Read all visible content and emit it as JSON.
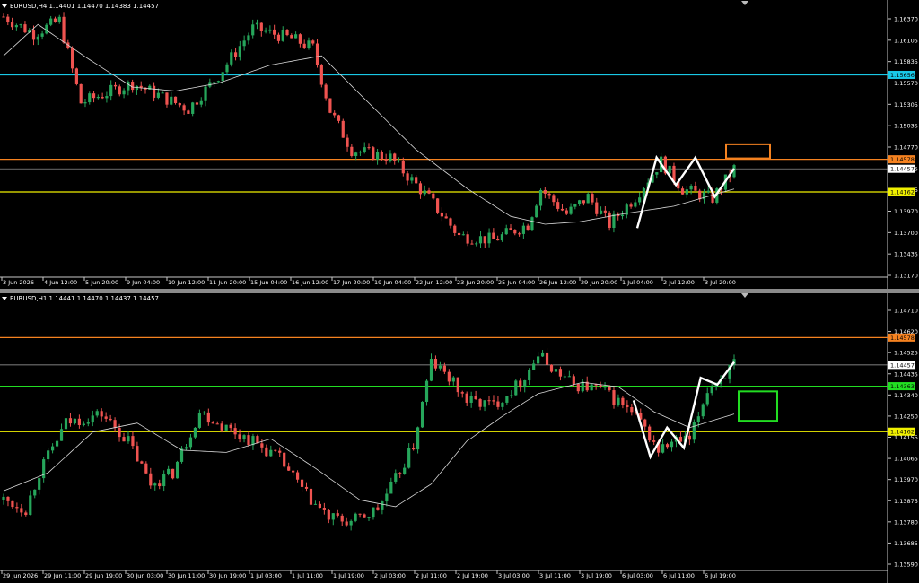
{
  "chart_data": [
    {
      "type": "candlestick",
      "title": "EURUSD,H4  1.14401 1.14470 1.14383 1.14457",
      "yticks": [
        "1.16370",
        "1.16105",
        "1.15835",
        "1.15570",
        "1.15305",
        "1.15035",
        "1.14770",
        "1.14505",
        "1.14235",
        "1.13970",
        "1.13700",
        "1.13435",
        "1.13170"
      ],
      "ylim": [
        1.1312,
        1.1652
      ],
      "xticks": [
        "3 Jun 2026",
        "4 Jun 12:00",
        "5 Jun 20:00",
        "9 Jun 04:00",
        "10 Jun 12:00",
        "11 Jun 20:00",
        "15 Jun 04:00",
        "16 Jun 12:00",
        "17 Jun 20:00",
        "19 Jun 04:00",
        "22 Jun 12:00",
        "23 Jun 20:00",
        "25 Jun 04:00",
        "26 Jun 12:00",
        "29 Jun 20:00",
        "1 Jul 04:00",
        "2 Jul 12:00",
        "3 Jul 20:00"
      ],
      "hlines": [
        {
          "value": 1.15656,
          "label": "1.15656",
          "color": "#19c8e6"
        },
        {
          "value": 1.14578,
          "label": "1.14578",
          "color": "#f58220"
        },
        {
          "value": 1.14457,
          "label": "1.14457",
          "color": "#aaaaaa"
        },
        {
          "value": 1.14162,
          "label": "1.14162",
          "color": "#f0f000"
        }
      ],
      "box": {
        "color": "#f58220",
        "price_top": 1.1477,
        "price_bottom": 1.1459
      },
      "zigzag": [
        1.137,
        1.146,
        1.1425,
        1.146,
        1.141,
        1.1446
      ],
      "anchors": [
        {
          "i": 0,
          "v": 1.164
        },
        {
          "i": 7,
          "v": 1.1618
        },
        {
          "i": 13,
          "v": 1.1635
        },
        {
          "i": 18,
          "v": 1.153
        },
        {
          "i": 30,
          "v": 1.1555
        },
        {
          "i": 43,
          "v": 1.1522
        },
        {
          "i": 50,
          "v": 1.1565
        },
        {
          "i": 58,
          "v": 1.1625
        },
        {
          "i": 67,
          "v": 1.1612
        },
        {
          "i": 72,
          "v": 1.16
        },
        {
          "i": 76,
          "v": 1.152
        },
        {
          "i": 81,
          "v": 1.147
        },
        {
          "i": 90,
          "v": 1.146
        },
        {
          "i": 99,
          "v": 1.1408
        },
        {
          "i": 106,
          "v": 1.136
        },
        {
          "i": 114,
          "v": 1.1355
        },
        {
          "i": 122,
          "v": 1.1375
        },
        {
          "i": 125,
          "v": 1.142
        },
        {
          "i": 131,
          "v": 1.1388
        },
        {
          "i": 136,
          "v": 1.141
        },
        {
          "i": 141,
          "v": 1.1375
        },
        {
          "i": 147,
          "v": 1.141
        },
        {
          "i": 153,
          "v": 1.1455
        },
        {
          "i": 158,
          "v": 1.142
        },
        {
          "i": 165,
          "v": 1.1408
        },
        {
          "i": 170,
          "v": 1.1446
        }
      ],
      "ma": [
        {
          "i": 0,
          "v": 1.159
        },
        {
          "i": 8,
          "v": 1.163
        },
        {
          "i": 20,
          "v": 1.1585
        },
        {
          "i": 30,
          "v": 1.155
        },
        {
          "i": 40,
          "v": 1.1545
        },
        {
          "i": 50,
          "v": 1.1555
        },
        {
          "i": 62,
          "v": 1.1578
        },
        {
          "i": 74,
          "v": 1.159
        },
        {
          "i": 84,
          "v": 1.1535
        },
        {
          "i": 96,
          "v": 1.147
        },
        {
          "i": 108,
          "v": 1.142
        },
        {
          "i": 118,
          "v": 1.1385
        },
        {
          "i": 126,
          "v": 1.1375
        },
        {
          "i": 134,
          "v": 1.1378
        },
        {
          "i": 144,
          "v": 1.1388
        },
        {
          "i": 156,
          "v": 1.1398
        },
        {
          "i": 170,
          "v": 1.142
        }
      ]
    },
    {
      "type": "candlestick",
      "title": "EURUSD,H1  1.14441 1.14470 1.14437 1.14457",
      "yticks": [
        "1.14710",
        "1.14620",
        "1.14525",
        "1.14435",
        "1.14340",
        "1.14250",
        "1.14155",
        "1.14065",
        "1.13970",
        "1.13875",
        "1.13780",
        "1.13685",
        "1.13590"
      ],
      "ylim": [
        1.1356,
        1.1475
      ],
      "xticks": [
        "29 Jun 2026",
        "29 Jun 11:00",
        "29 Jun 19:00",
        "30 Jun 03:00",
        "30 Jun 11:00",
        "30 Jun 19:00",
        "1 Jul 03:00",
        "1 Jul 11:00",
        "1 Jul 19:00",
        "2 Jul 03:00",
        "2 Jul 11:00",
        "2 Jul 19:00",
        "3 Jul 03:00",
        "3 Jul 11:00",
        "3 Jul 19:00",
        "6 Jul 03:00",
        "6 Jul 11:00",
        "6 Jul 19:00"
      ],
      "hlines": [
        {
          "value": 1.14578,
          "label": "1.14578",
          "color": "#f58220"
        },
        {
          "value": 1.14457,
          "label": "1.14457",
          "color": "#aaaaaa"
        },
        {
          "value": 1.14363,
          "label": "1.14363",
          "color": "#22dd22"
        },
        {
          "value": 1.14162,
          "label": "1.14162",
          "color": "#f0f000"
        }
      ],
      "box": {
        "color": "#22dd22",
        "price_top": 1.1434,
        "price_bottom": 1.1421
      },
      "zigzag": [
        1.143,
        1.1405,
        1.1418,
        1.1409,
        1.144,
        1.1437,
        1.1447
      ],
      "anchors": [
        {
          "i": 0,
          "v": 1.1386
        },
        {
          "i": 5,
          "v": 1.1382
        },
        {
          "i": 8,
          "v": 1.1398
        },
        {
          "i": 14,
          "v": 1.142
        },
        {
          "i": 22,
          "v": 1.1424
        },
        {
          "i": 28,
          "v": 1.1412
        },
        {
          "i": 33,
          "v": 1.1393
        },
        {
          "i": 38,
          "v": 1.1398
        },
        {
          "i": 44,
          "v": 1.1425
        },
        {
          "i": 50,
          "v": 1.1418
        },
        {
          "i": 56,
          "v": 1.1412
        },
        {
          "i": 62,
          "v": 1.1404
        },
        {
          "i": 68,
          "v": 1.1388
        },
        {
          "i": 73,
          "v": 1.1378
        },
        {
          "i": 78,
          "v": 1.1376
        },
        {
          "i": 84,
          "v": 1.1382
        },
        {
          "i": 88,
          "v": 1.1395
        },
        {
          "i": 92,
          "v": 1.141
        },
        {
          "i": 96,
          "v": 1.1447
        },
        {
          "i": 100,
          "v": 1.144
        },
        {
          "i": 104,
          "v": 1.143
        },
        {
          "i": 110,
          "v": 1.1428
        },
        {
          "i": 116,
          "v": 1.1438
        },
        {
          "i": 120,
          "v": 1.145
        },
        {
          "i": 124,
          "v": 1.1443
        },
        {
          "i": 128,
          "v": 1.1437
        },
        {
          "i": 134,
          "v": 1.1435
        },
        {
          "i": 139,
          "v": 1.1428
        },
        {
          "i": 143,
          "v": 1.142
        },
        {
          "i": 147,
          "v": 1.1408
        },
        {
          "i": 151,
          "v": 1.1412
        },
        {
          "i": 154,
          "v": 1.1412
        },
        {
          "i": 158,
          "v": 1.1435
        },
        {
          "i": 161,
          "v": 1.144
        },
        {
          "i": 164,
          "v": 1.1446
        }
      ],
      "ma": [
        {
          "i": 0,
          "v": 1.139
        },
        {
          "i": 10,
          "v": 1.1398
        },
        {
          "i": 20,
          "v": 1.1416
        },
        {
          "i": 30,
          "v": 1.142
        },
        {
          "i": 40,
          "v": 1.1408
        },
        {
          "i": 50,
          "v": 1.1407
        },
        {
          "i": 60,
          "v": 1.1413
        },
        {
          "i": 70,
          "v": 1.14
        },
        {
          "i": 80,
          "v": 1.1386
        },
        {
          "i": 88,
          "v": 1.1383
        },
        {
          "i": 96,
          "v": 1.1393
        },
        {
          "i": 104,
          "v": 1.1412
        },
        {
          "i": 112,
          "v": 1.1423
        },
        {
          "i": 120,
          "v": 1.1433
        },
        {
          "i": 130,
          "v": 1.1438
        },
        {
          "i": 138,
          "v": 1.1436
        },
        {
          "i": 146,
          "v": 1.1425
        },
        {
          "i": 154,
          "v": 1.1418
        },
        {
          "i": 164,
          "v": 1.1424
        }
      ]
    }
  ]
}
